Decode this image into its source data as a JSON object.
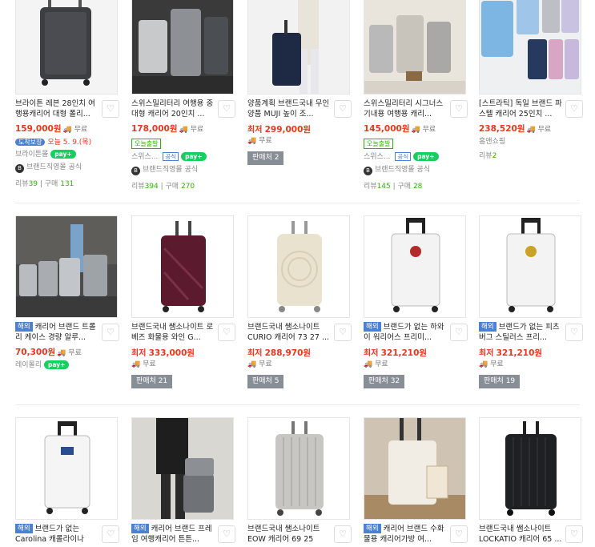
{
  "rows": [
    [
      {
        "title": "브라이튼 레븐 28인치 여행용캐리어 대형 폴리...",
        "price": "159,000원",
        "shipping": "무료",
        "delivery": {
          "badge": "도착보장",
          "day": "오늘 5. 9.(목)"
        },
        "seller": "브라이튼몰",
        "npay": "pay+",
        "official": "브랜드직영몰 공식",
        "review_label": "리뷰",
        "review": "39",
        "purchase_label": "구매",
        "purchase": "131"
      },
      {
        "title": "스위스밀리터리 여행용 중대형 캐리어 20인치 ...",
        "price": "178,000원",
        "shipping": "무료",
        "today_tag": "오늘출발",
        "seller": "스위스...",
        "official_tag": "공식",
        "npay": "pay+",
        "official": "브랜드직영몰 공식",
        "review_label": "리뷰",
        "review": "394",
        "purchase_label": "구매",
        "purchase": "270"
      },
      {
        "title": "양품계획 브랜드국내 무인양품 MUJI 높이 조...",
        "min_label": "최저",
        "price": "299,000원",
        "shipping": "무료",
        "sellers": "판매처 2"
      },
      {
        "title": "스위스밀리터리 시그너스 기내용 여행용 캐리...",
        "price": "145,000원",
        "shipping": "무료",
        "today_tag": "오늘출발",
        "seller": "스위스...",
        "official_tag": "공식",
        "npay": "pay+",
        "official": "브랜드직영몰 공식",
        "review_label": "리뷰",
        "review": "145",
        "purchase_label": "구매",
        "purchase": "28"
      },
      {
        "title": "[스트라틱] 독일 브랜드 파스텔 캐리어 25인치 ...",
        "price": "238,520원",
        "shipping": "무료",
        "seller": "홈앤쇼핑",
        "review_label": "리뷰",
        "review": "2"
      }
    ],
    [
      {
        "overseas": "해외",
        "title": "캐리어 브랜드 트롤리 케이스 경량 알루...",
        "price": "70,300원",
        "shipping": "무료",
        "seller": "레이몰리",
        "npay": "pay+"
      },
      {
        "title": "브랜드국내 쌤소나이트 로베즈 화물용 와인 G...",
        "min_label": "최저",
        "price": "333,000원",
        "shipping": "무료",
        "sellers": "판매처 21"
      },
      {
        "title": "브랜드국내 쌤소나이트 CURIO 캐리어 73 27 ...",
        "min_label": "최저",
        "price": "288,970원",
        "shipping": "무료",
        "sellers": "판매처 5"
      },
      {
        "overseas": "해외",
        "title": "브랜드가 없는 하와이 워리어스 프리미...",
        "min_label": "최저",
        "price": "321,210원",
        "shipping": "무료",
        "sellers": "판매처 32"
      },
      {
        "overseas": "해외",
        "title": "브랜드가 없는 피츠버그 스틸러스 프리...",
        "min_label": "최저",
        "price": "321,210원",
        "shipping": "무료",
        "sellers": "판매처 19"
      }
    ],
    [
      {
        "overseas": "해외",
        "title": "브랜드가 없는 Carolina 캐롤라이나 Pant..."
      },
      {
        "overseas": "해외",
        "title": "캐리어 브랜드 프레임 여행캐리어 튼튼..."
      },
      {
        "title": "브랜드국내 쌤소나이트 EOW 캐리어 69 25 EX..."
      },
      {
        "overseas": "해외",
        "title": "캐리어 브랜드 수화물용 캐리어가방 여..."
      },
      {
        "title": "브랜드국내 쌤소나이트 LOCKATIO 캐리어 65 ..."
      }
    ]
  ],
  "icons": {
    "heart": "heart-icon",
    "talk": "talk-icon",
    "truck": "truck-icon"
  },
  "colors": {
    "price": "#e8371b",
    "green": "#2db400",
    "overseas": "#4a80d6"
  }
}
